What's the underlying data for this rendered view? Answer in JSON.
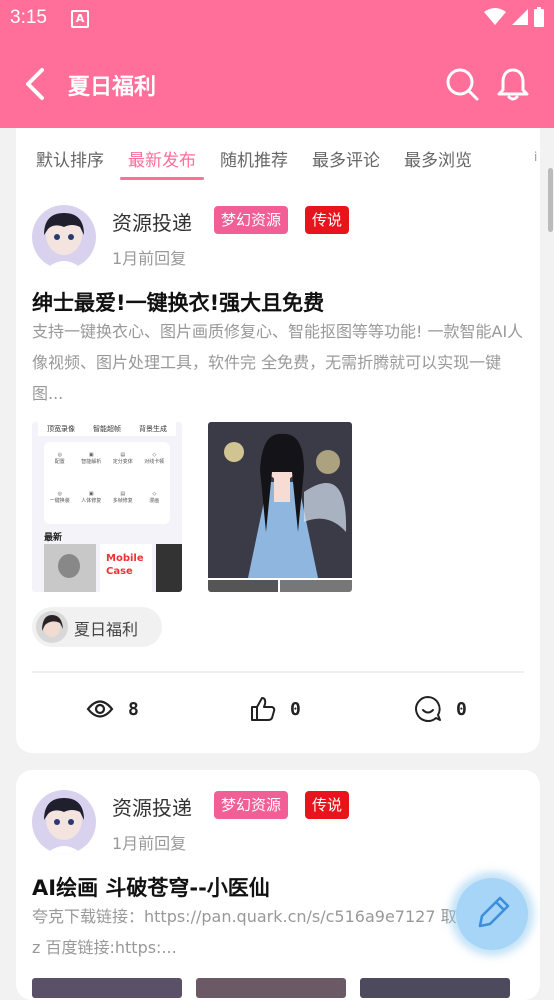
{
  "status_bar": {
    "time": "3:15",
    "notification_icon": "A"
  },
  "header": {
    "title": "夏日福利"
  },
  "tabs": [
    "默认排序",
    "最新发布",
    "随机推荐",
    "最多评论",
    "最多浏览"
  ],
  "active_tab": 1,
  "posts": [
    {
      "author": "资源投递",
      "badges": [
        "梦幻资源",
        "传说"
      ],
      "time": "1月前回复",
      "title": "绅士最爱!一键换衣!强大且免费",
      "body": "支持一键换衣心、图片画质修复心、智能抠图等等功能! 一款智能AI人像视频、图片处理工具，软件完 全免费，无需折腾就可以实现一键图...",
      "thumb_text": {
        "menu_a": "顶宽录像",
        "menu_b": "智能超帧",
        "menu_c": "背景生成",
        "icons": [
          "配置",
          "智能解析",
          "定分变体",
          "对线卡顿",
          "一键换装",
          "人体修复",
          "多帧修复",
          "漫画"
        ],
        "section": "最新",
        "case_text": "Mobile Case"
      },
      "tag": "夏日福利",
      "stats": {
        "views": "8",
        "likes": "0",
        "comments": "0"
      }
    },
    {
      "author": "资源投递",
      "badges": [
        "梦幻资源",
        "传说"
      ],
      "time": "1月前回复",
      "title": "AI绘画 斗破苍穹--小医仙",
      "body": "夸克下载链接：https://pan.quark.cn/s/c516a9e7127 取码：xGVz 百度链接:https:..."
    }
  ],
  "colors": {
    "brand": "#ff6f9a",
    "badge_pink": "#f25e96",
    "badge_red": "#e8141d",
    "fab": "#a7d5f7"
  }
}
